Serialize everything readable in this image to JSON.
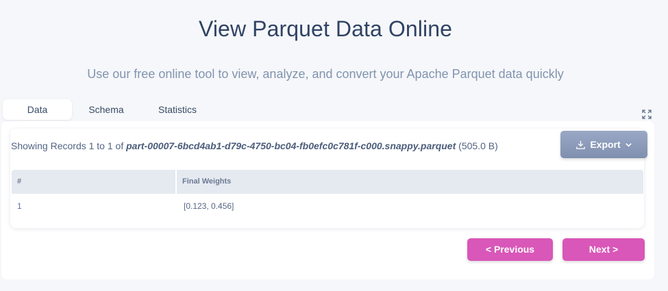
{
  "header": {
    "title": "View Parquet Data Online",
    "subtitle": "Use our free online tool to view, analyze, and convert your Apache Parquet data quickly"
  },
  "tabs": [
    {
      "label": "Data",
      "active": true
    },
    {
      "label": "Schema",
      "active": false
    },
    {
      "label": "Statistics",
      "active": false
    }
  ],
  "summary": {
    "prefix": "Showing Records 1 to 1 of",
    "filename": "part-00007-6bcd4ab1-d79c-4750-bc04-fb0efc0c781f-c000.snappy.parquet",
    "size": "(505.0 B)"
  },
  "export": {
    "label": "Export",
    "icon": "download-icon"
  },
  "table": {
    "columns": [
      "#",
      "Final Weights"
    ],
    "rows": [
      [
        "1",
        "[0.123, 0.456]"
      ]
    ]
  },
  "pagination": {
    "prev_label": "< Previous",
    "next_label": "Next >"
  },
  "colors": {
    "accent": "#d957b8",
    "export_bg": "#8e9cbc",
    "title": "#2f4364"
  }
}
